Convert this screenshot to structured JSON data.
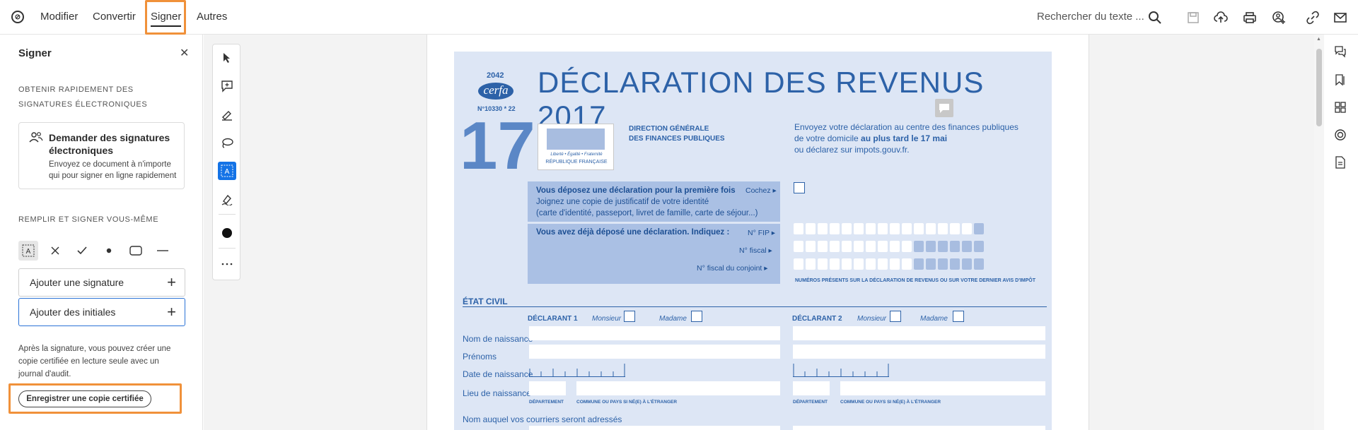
{
  "menu": {
    "items": [
      {
        "label": "Modifier"
      },
      {
        "label": "Convertir"
      },
      {
        "label": "Signer"
      },
      {
        "label": "Autres"
      }
    ],
    "search_label": "Rechercher du texte ..."
  },
  "panel": {
    "title": "Signer",
    "section1": "OBTENIR RAPIDEMENT DES SIGNATURES ÉLECTRONIQUES",
    "card_title": "Demander des signatures électroniques",
    "card_desc": "Envoyez ce document à n'importe qui pour signer en ligne rapidement",
    "section2": "REMPLIR ET SIGNER VOUS-MÊME",
    "tools": [
      "text-field-icon",
      "cross-icon",
      "checkmark-icon",
      "dot-icon",
      "rectangle-icon",
      "line-icon"
    ],
    "add_signature": "Ajouter une signature",
    "add_initials": "Ajouter des initiales",
    "note": "Après la signature, vous pouvez créer une copie certifiée en lecture seule avec un journal d'audit.",
    "cert_button": "Enregistrer une copie certifiée"
  },
  "form": {
    "cerfa_num": "2042",
    "cerfa_logo": "cerfa",
    "cerfa_ref": "N°10330 * 22",
    "title": "DÉCLARATION DES REVENUS 2017",
    "big_number": "17",
    "republic_motto": "Liberté • Égalité • Fraternité",
    "republic": "RÉPUBLIQUE FRANÇAISE",
    "direction1": "DIRECTION GÉNÉRALE",
    "direction2": "DES FINANCES PUBLIQUES",
    "notice1": "Envoyez votre déclaration au centre des finances publiques",
    "notice2a": "de votre domicile ",
    "notice2b": "au plus tard le 17 mai",
    "notice3": "ou déclarez sur impots.gouv.fr.",
    "first_time": "Vous déposez une déclaration pour la première fois",
    "cochez": "Cochez ▸",
    "justif1": "Joignez une copie de justificatif de votre identité",
    "justif2": "(carte d'identité, passeport, livret de famille, carte de séjour...)",
    "already": "Vous avez déjà déposé une déclaration. Indiquez :",
    "fip": "N° FIP ▸",
    "fiscal": "N° fiscal ▸",
    "fiscal_conjoint": "N° fiscal du conjoint ▸",
    "numbers_note": "NUMÉROS PRÉSENTS SUR LA DÉCLARATION DE REVENUS OU SUR VOTRE DERNIER AVIS D'IMPÔT",
    "etat_civil": "ÉTAT CIVIL",
    "declarant1": "DÉCLARANT 1",
    "declarant2": "DÉCLARANT 2",
    "monsieur": "Monsieur",
    "madame": "Madame",
    "nom_naissance": "Nom de naissance",
    "prenoms": "Prénoms",
    "date_naissance": "Date de naissance",
    "lieu_naissance": "Lieu de naissance",
    "departement": "DÉPARTEMENT",
    "commune": "COMMUNE OU PAYS SI NÉ(E) À L'ÉTRANGER",
    "courriers": "Nom auquel vos courriers seront adressés"
  }
}
